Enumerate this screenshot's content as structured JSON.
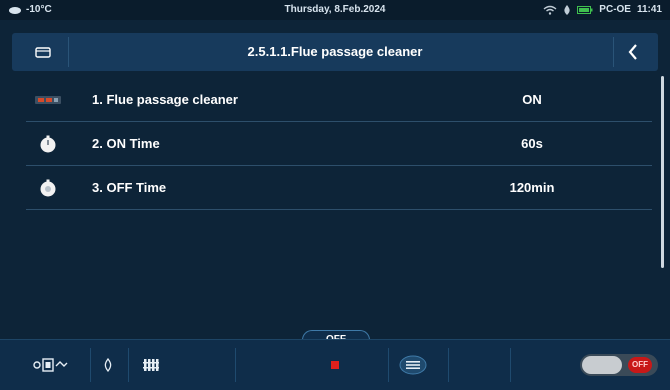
{
  "status_bar": {
    "outdoor_temp": "-10°C",
    "date": "Thursday, 8.Feb.2024",
    "device": "PC-OE",
    "time": "11:41"
  },
  "header": {
    "title": "2.5.1.1.Flue passage cleaner"
  },
  "rows": [
    {
      "label": "1.  Flue passage cleaner",
      "value": "ON",
      "icon": "cleaner-icon"
    },
    {
      "label": "2.  ON Time",
      "value": "60s",
      "icon": "timer-on-icon"
    },
    {
      "label": "3.  OFF Time",
      "value": "120min",
      "icon": "timer-off-icon"
    }
  ],
  "bottom_bar": {
    "mode_label": "OFF",
    "toggle_state": "OFF"
  },
  "colors": {
    "background": "#0d2438",
    "header": "#173a5c",
    "status_red": "#c81818"
  }
}
